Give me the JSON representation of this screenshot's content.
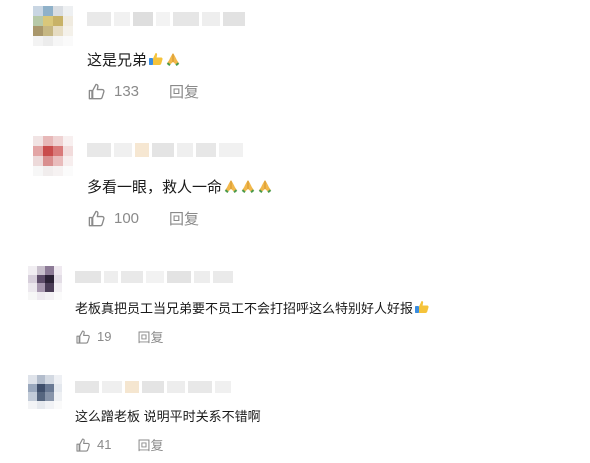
{
  "comments": [
    {
      "text": "这是兄弟",
      "emoji": [
        "thumbs-up",
        "folded-hands"
      ],
      "like_count": "133",
      "reply_label": "回复",
      "avatar_colors": [
        "#c9d6e3",
        "#8fb1c9",
        "#d9dde2",
        "#eef0f2",
        "#b7c9a8",
        "#d9c77a",
        "#c8b267",
        "#f0ebe0",
        "#a9976b",
        "#c6b783",
        "#e6dcc2",
        "#f4f1ea",
        "#f3f3f3",
        "#ececec",
        "#f6f6f6",
        "#fafafa"
      ],
      "name_colors": [
        "#e9e9e9",
        "#f1f1f1",
        "#dedede",
        "#f3f3f3",
        "#e6e6e6",
        "#eeeeee",
        "#e2e2e2"
      ]
    },
    {
      "text": "多看一眼，救人一命",
      "emoji": [
        "folded-hands",
        "folded-hands",
        "folded-hands"
      ],
      "like_count": "100",
      "reply_label": "回复",
      "avatar_colors": [
        "#f1e4e4",
        "#e7b8b8",
        "#efd3d3",
        "#f8f0f0",
        "#e3a5a5",
        "#c94c4c",
        "#d97a7a",
        "#f2dcdc",
        "#eddada",
        "#d98f8f",
        "#e9bcbc",
        "#f7eeee",
        "#f7f7f7",
        "#f1eded",
        "#f6f2f2",
        "#fbfbfb"
      ],
      "name_colors": [
        "#e8e8e8",
        "#f0f0f0",
        "#f6e7d2",
        "#e4e4e4",
        "#efefef",
        "#e7e7e7",
        "#f1f1f1"
      ]
    },
    {
      "text": "老板真把员工当兄弟要不员工不会打招呼这么特别好人好报",
      "emoji": [
        "thumbs-up"
      ],
      "like_count": "19",
      "reply_label": "回复",
      "avatar_colors": [
        "#f1eef2",
        "#c8bfcc",
        "#8c7a96",
        "#efe9f0",
        "#d7cfdb",
        "#5e4d6a",
        "#2c2236",
        "#e3dde6",
        "#ece8ee",
        "#a898b0",
        "#4b3d57",
        "#f2eff3",
        "#f7f7f7",
        "#eeeaf0",
        "#f3f1f4",
        "#fbfbfb"
      ],
      "name_colors": [
        "#e5e5e5",
        "#eeeeee",
        "#e9e9e9",
        "#f2f2f2",
        "#e3e3e3",
        "#ededed",
        "#eaeaea"
      ]
    },
    {
      "text": "这么蹭老板 说明平时关系不错啊",
      "emoji": [],
      "like_count": "41",
      "reply_label": "回复",
      "avatar_colors": [
        "#dfe3ea",
        "#b3bdcc",
        "#d3d9e2",
        "#eef0f4",
        "#9aa8bd",
        "#3f4f6b",
        "#6a7a94",
        "#e4e8ee",
        "#c2cbd8",
        "#56667f",
        "#8895aa",
        "#eef0f3",
        "#f3f4f6",
        "#e6e9ee",
        "#f1f2f5",
        "#fafafa"
      ],
      "name_colors": [
        "#e6e6e6",
        "#efefef",
        "#f5e6d0",
        "#e4e4e4",
        "#ededed",
        "#e8e8e8",
        "#f0f0f0"
      ]
    }
  ]
}
